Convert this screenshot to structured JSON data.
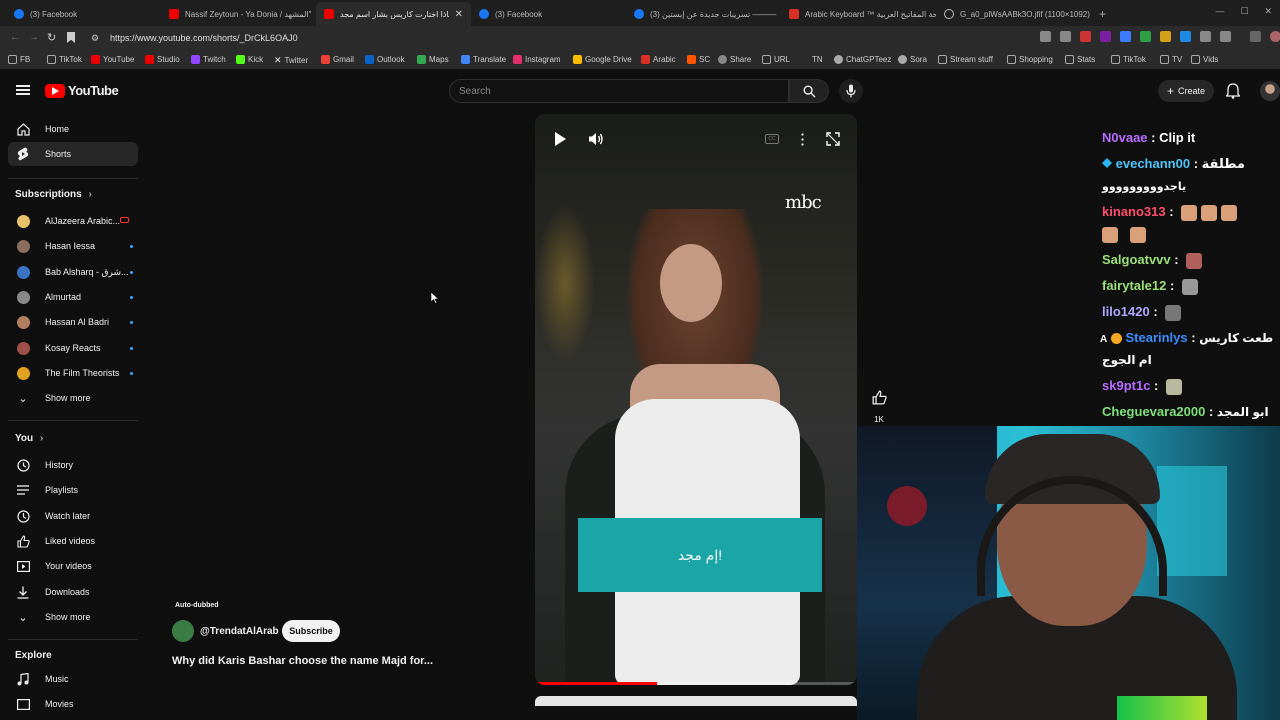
{
  "tabs": [
    {
      "title": "(3) Facebook",
      "icon": "facebook-icon"
    },
    {
      "title": "Nassif Zeytoun - Ya Donia / المشهد\"",
      "icon": "youtube-icon"
    },
    {
      "title": "لماذا اختارت كاريس بشار اسم مجد",
      "icon": "youtube-icon",
      "active": true
    },
    {
      "title": "(3) Facebook",
      "icon": "facebook-icon"
    },
    {
      "title": "(3) تسريبات جديدة عن إبستين ———",
      "icon": "facebook-icon"
    },
    {
      "title": "Arabic Keyboard ™ لوحة المفاتيح العربية",
      "icon": "arabic-keyboard-icon"
    },
    {
      "title": "G_a0_plWsAABk3O.jfif (1100×1092)",
      "icon": "globe-icon"
    }
  ],
  "address": {
    "url": "https://www.youtube.com/shorts/_DrCkL6OAJ0"
  },
  "bookmarks": [
    "FB",
    "TikTok",
    "YouTube",
    "Studio",
    "Twitch",
    "Kick",
    "Twitter",
    "Gmail",
    "Outlook",
    "Maps",
    "Translate",
    "Instagram",
    "Google Drive",
    "Arabic",
    "SC",
    "Share",
    "URL",
    "TN",
    "ChatGPTeez",
    "Sora",
    "Stream stuff",
    "Shopping",
    "Stats",
    "TikTok",
    "TV",
    "Vids"
  ],
  "header": {
    "logo_text": "YouTube",
    "search_placeholder": "Search",
    "create_label": "Create"
  },
  "sidebar": {
    "main": [
      {
        "label": "Home",
        "icon": "home-icon"
      },
      {
        "label": "Shorts",
        "icon": "shorts-icon",
        "active": true
      }
    ],
    "subscriptions_title": "Subscriptions",
    "subscriptions": [
      {
        "label": "AlJazeera Arabic...",
        "color": "#e8c26a",
        "live": true
      },
      {
        "label": "Hasan Iessa",
        "color": "#8a6d5a"
      },
      {
        "label": "Bab Alsharq - شرق...",
        "color": "#3a73c4"
      },
      {
        "label": "Almurtad",
        "color": "#888888"
      },
      {
        "label": "Hassan Al Badri",
        "color": "#b08060"
      },
      {
        "label": "Kosay Reacts",
        "color": "#a0504a"
      },
      {
        "label": "The Film Theorists",
        "color": "#e0a020"
      }
    ],
    "subs_show_more": "Show more",
    "you_title": "You",
    "you_items": [
      {
        "label": "History",
        "icon": "history-icon"
      },
      {
        "label": "Playlists",
        "icon": "playlists-icon"
      },
      {
        "label": "Watch later",
        "icon": "watch-later-icon"
      },
      {
        "label": "Liked videos",
        "icon": "like-icon"
      },
      {
        "label": "Your videos",
        "icon": "your-videos-icon"
      },
      {
        "label": "Downloads",
        "icon": "download-icon"
      }
    ],
    "you_show_more": "Show more",
    "explore_title": "Explore",
    "explore_items": [
      {
        "label": "Music",
        "icon": "music-icon"
      },
      {
        "label": "Movies",
        "icon": "movies-icon"
      }
    ]
  },
  "short": {
    "overlay_logo": "mbc",
    "caption": "إم مجد!",
    "like_count": "1K",
    "progress": 0.38,
    "auto_dubbed": "Auto-dubbed",
    "channel": "@TrendatAlArab",
    "subscribe_label": "Subscribe",
    "title": "Why did Karis Bashar choose the name Majd for..."
  },
  "chat": [
    {
      "user": "N0vaae",
      "color": "#b86bff",
      "msg": "Clip it"
    },
    {
      "user": "evechann00",
      "color": "#4fc3f7",
      "msg": "مطلقة",
      "line2": "ياجدووووووووو",
      "badge": true
    },
    {
      "user": "kinano313",
      "color": "#ff4d6a",
      "msg": "",
      "emotes": 5
    },
    {
      "user": "Salgoatvvv",
      "color": "#9be07a",
      "msg": "",
      "emotes": 1
    },
    {
      "user": "fairytale12",
      "color": "#9be07a",
      "msg": "",
      "emotes": 1
    },
    {
      "user": "lilo1420",
      "color": "#b0a6ff",
      "msg": "",
      "emotes": 1
    },
    {
      "user": "Stearinlys",
      "color": "#3b8cff",
      "msg": "طعت كاريس",
      "line2": "ام الجوج",
      "prefix": "A"
    },
    {
      "user": "sk9pt1c",
      "color": "#b86bff",
      "msg": "",
      "emotes": 1
    },
    {
      "user": "Cheguevara2000",
      "color": "#7ee07a",
      "msg": "ابو المجد"
    }
  ]
}
